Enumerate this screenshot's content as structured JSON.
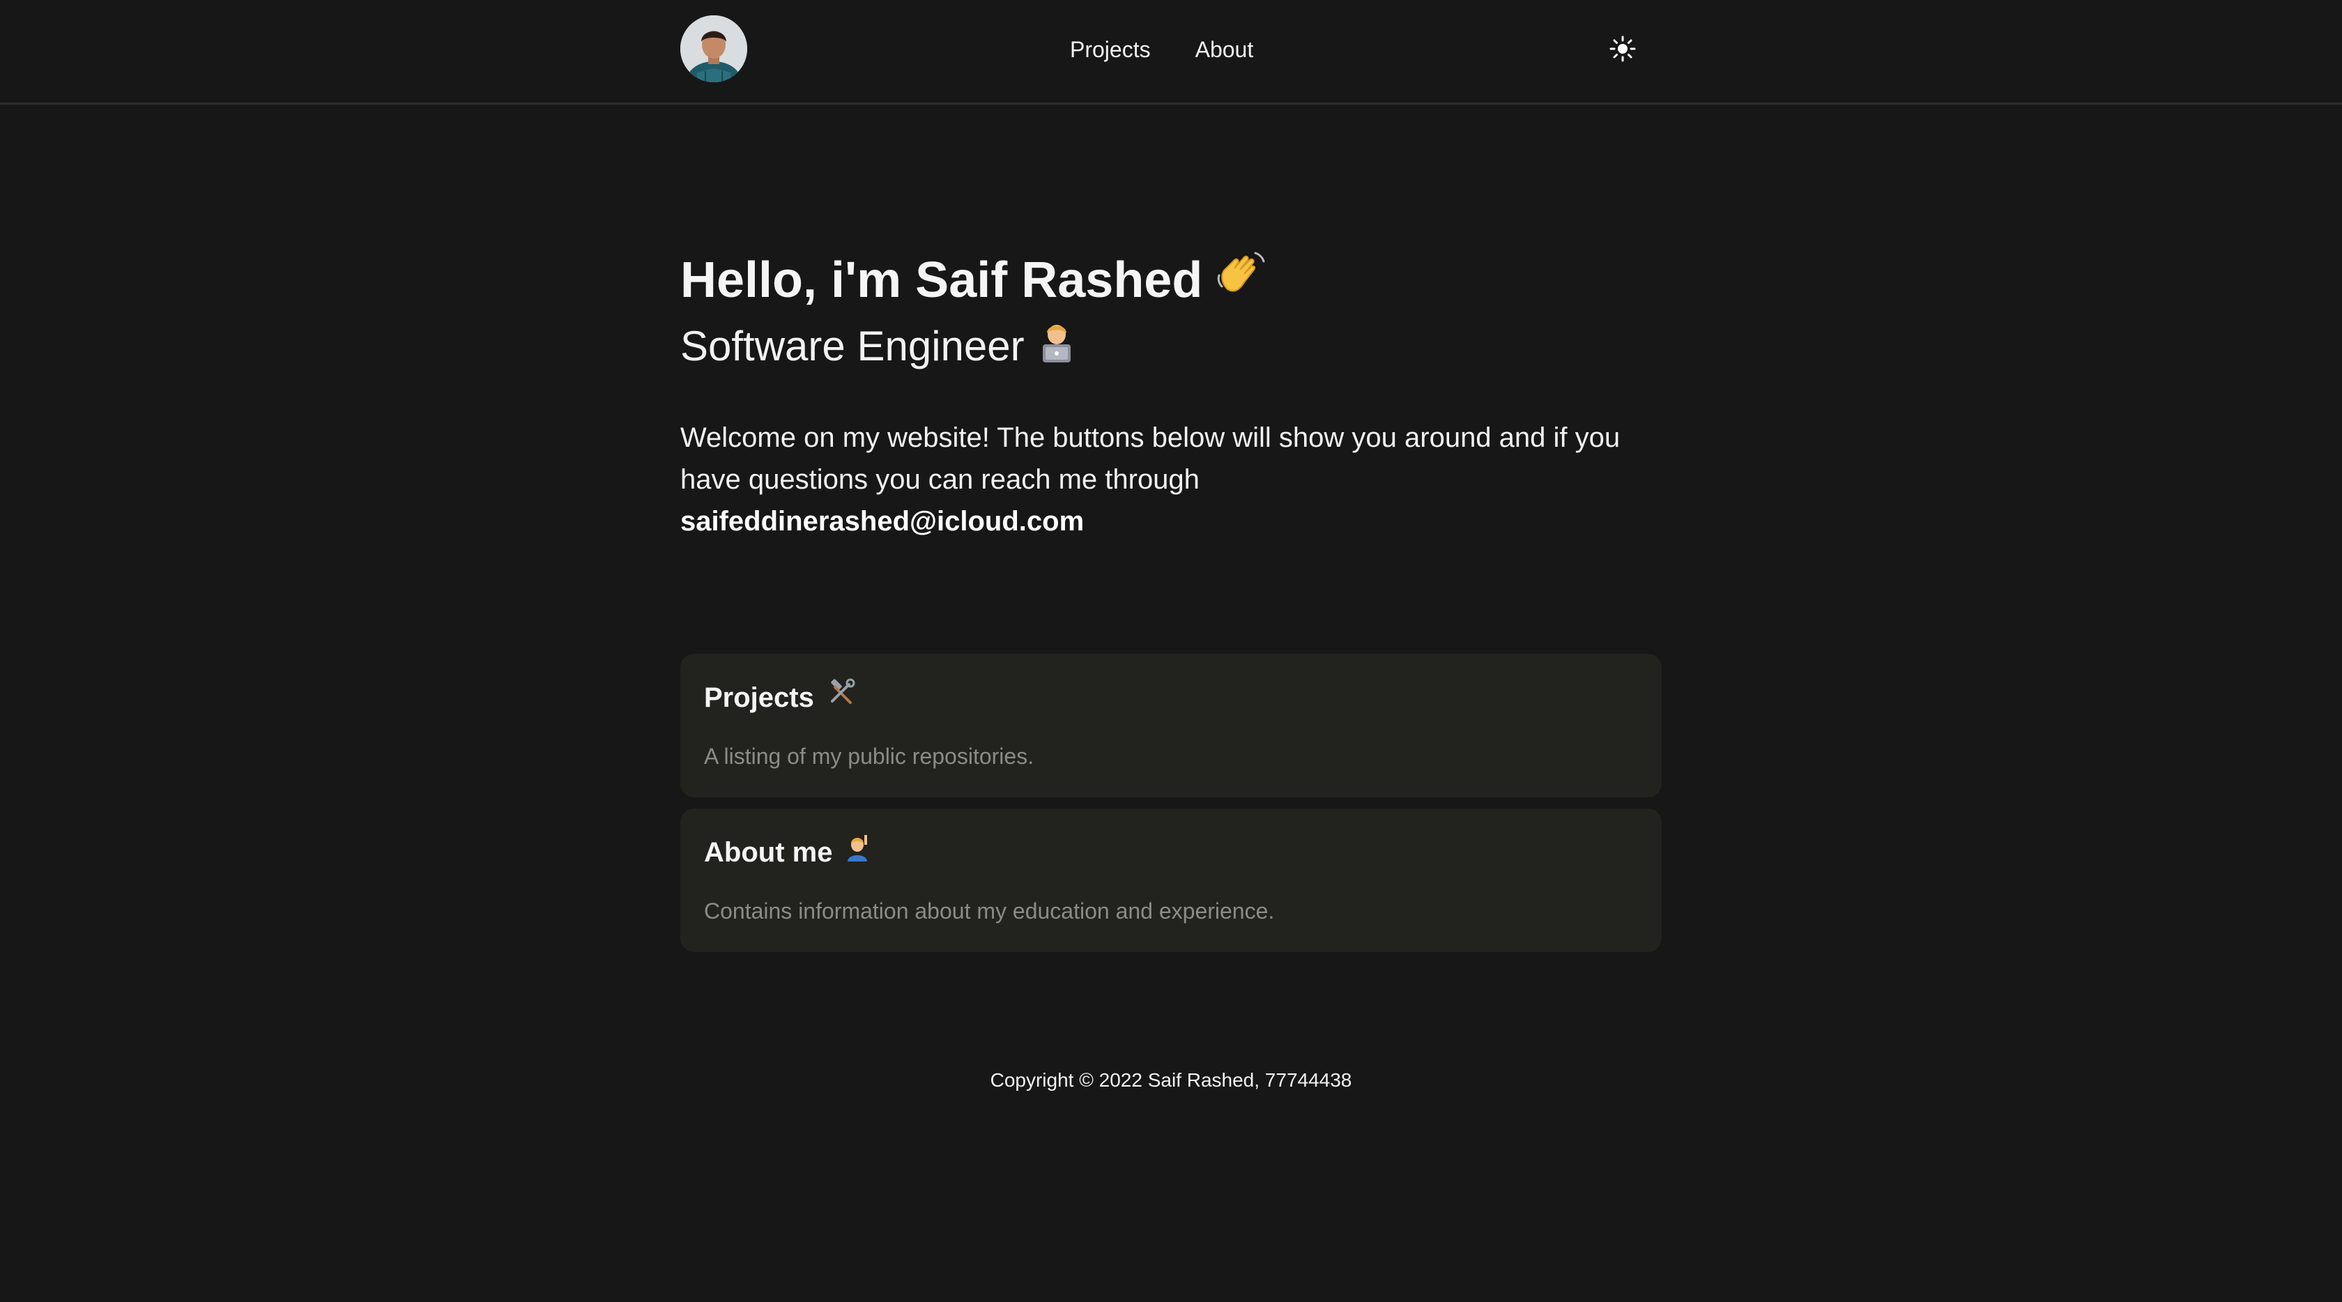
{
  "header": {
    "avatar_alt": "Profile photo",
    "nav": [
      {
        "label": "Projects"
      },
      {
        "label": "About"
      }
    ],
    "theme_icon": "sun-icon"
  },
  "hero": {
    "title": "Hello, i'm Saif Rashed",
    "title_emoji": "waving-hand-emoji",
    "subtitle": "Software Engineer",
    "subtitle_emoji": "technologist-emoji",
    "welcome_text": "Welcome on my website! The buttons below will show you around and if you have questions you can reach me through",
    "email": "saifeddinerashed@icloud.com"
  },
  "cards": [
    {
      "title": "Projects",
      "emoji": "hammer-wrench-emoji",
      "description": "A listing of my public repositories."
    },
    {
      "title": "About me",
      "emoji": "person-raising-hand-emoji",
      "description": "Contains information about my education and experience."
    }
  ],
  "footer": {
    "text": "Copyright © 2022 Saif Rashed, 77744438"
  },
  "colors": {
    "background": "#171717",
    "card": "#22221f",
    "muted_text": "#8b8b87",
    "border": "#2d2d2d"
  }
}
